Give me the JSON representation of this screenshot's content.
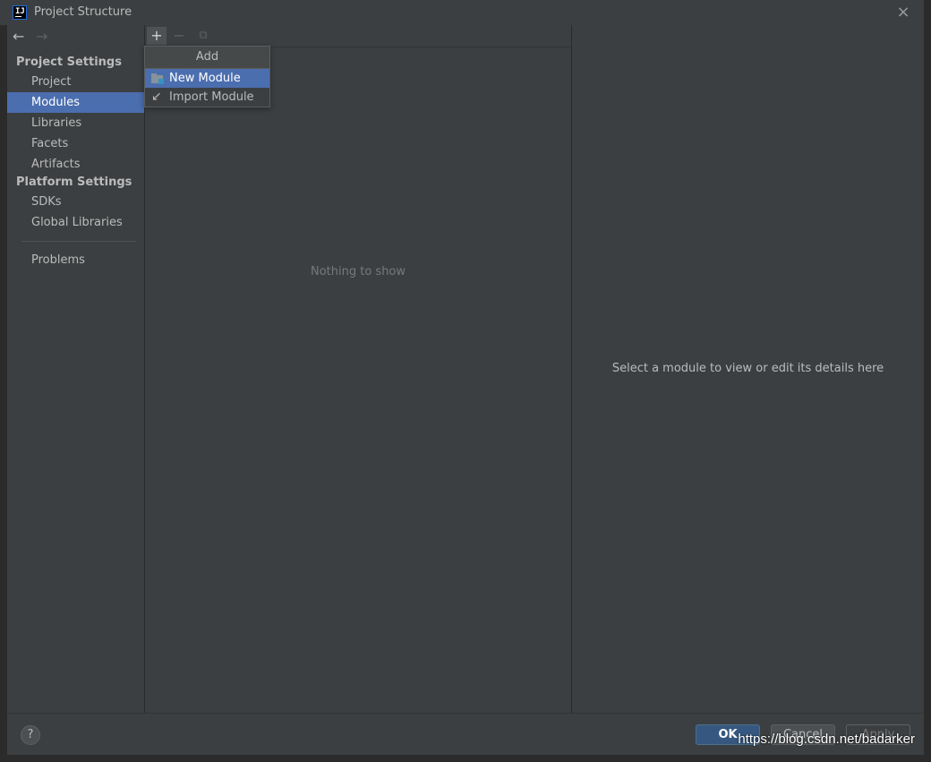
{
  "window": {
    "title": "Project Structure",
    "close_icon": "×"
  },
  "nav": {
    "back_icon": "←",
    "forward_icon": "→",
    "project_settings_title": "Project Settings",
    "project_items": [
      "Project",
      "Modules",
      "Libraries",
      "Facets",
      "Artifacts"
    ],
    "platform_settings_title": "Platform Settings",
    "platform_items": [
      "SDKs",
      "Global Libraries"
    ],
    "problems": "Problems",
    "selected": "Modules"
  },
  "toolbar": {
    "add_icon": "+",
    "remove_icon": "−",
    "copy_icon": "⧉"
  },
  "popup": {
    "title": "Add",
    "items": [
      "New Module",
      "Import Module"
    ],
    "selected": "New Module",
    "import_icon": "↙"
  },
  "middle": {
    "empty_text": "Nothing to show"
  },
  "details": {
    "hint": "Select a module to view or edit its details here"
  },
  "footer": {
    "help": "?",
    "ok": "OK",
    "cancel": "Cancel",
    "apply": "Apply"
  },
  "watermark": "https://blog.csdn.net/badarker",
  "colors": {
    "background": "#3c3f41",
    "selection": "#4b6eaf",
    "ok_button": "#365880"
  }
}
